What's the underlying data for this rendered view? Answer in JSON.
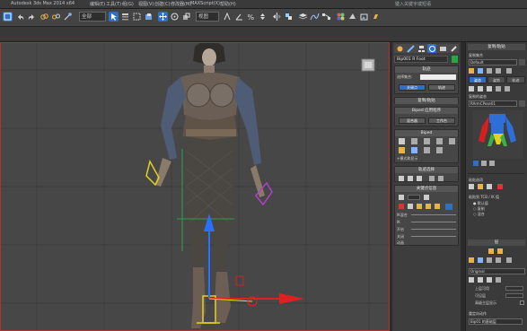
{
  "window": {
    "title_left": "Autodesk 3ds Max 2014 x64",
    "menu": [
      "编辑(E)",
      "工具(T)",
      "组(G)",
      "视图(V)",
      "创建(C)",
      "修改器(M)",
      "MAXScript(X)",
      "帮助(H)"
    ],
    "search": "键入关键字或短语"
  },
  "toolbar": {
    "selection_filter": "全部",
    "view_dropdown": "视图",
    "icons": [
      "undo-icon",
      "redo-icon",
      "link-icon",
      "unlink-icon",
      "bind-icon",
      "select-icon",
      "select-name-icon",
      "rect-select-icon",
      "window-crossing-icon",
      "move-icon",
      "rotate-icon",
      "scale-icon",
      "snap-icon",
      "angle-snap-icon",
      "percent-snap-icon",
      "spinner-snap-icon",
      "mirror-icon",
      "align-icon",
      "layer-icon",
      "curve-editor-icon",
      "schematic-icon",
      "material-editor-icon",
      "render-setup-icon",
      "render-frame-icon",
      "render-icon"
    ]
  },
  "command_panel": {
    "tabs": [
      "create-tab-icon",
      "modify-tab-icon",
      "hierarchy-tab-icon",
      "motion-tab-icon",
      "display-tab-icon",
      "utilities-tab-icon"
    ],
    "object_name": "Bip001 R Foot",
    "biped_rollout": {
      "title": "轨迹",
      "label": "选择集合:",
      "field": "无",
      "buttons": [
        "关键点",
        "轨迹"
      ]
    },
    "keyframe_rollout": {
      "title": "复制/粘贴"
    },
    "layers_rollout": {
      "title": "Biped 应用程序",
      "buttons": [
        "混合器",
        "工作台"
      ]
    },
    "biped_main": {
      "title": "Biped",
      "footer": "+模式和显示"
    },
    "track_rollout": {
      "title": "轨迹选择"
    },
    "copy_rollout": {
      "title": "关键点信息"
    },
    "ik_labels": [
      "IK混合",
      "IK",
      "开启",
      "关闭",
      "动画"
    ]
  },
  "right_panel": {
    "title": "复制/粘贴",
    "collection_label": "复制集合",
    "collection_value": "Default",
    "tabs": [
      "姿态",
      "姿势",
      "轨迹"
    ],
    "copied_label": "复制的姿态",
    "copied_value": "RArmCPose01",
    "options_title": "粘贴选项",
    "option_label": "粘贴到 TCB / IK 值",
    "radio": [
      "默认值",
      "复制",
      "混合"
    ],
    "lower_title": "层",
    "lower_field": "Original",
    "rows": [
      "上层可用",
      "可见层",
      "高级主层显示"
    ],
    "section": "重定向动作",
    "dropdown": "Bip01 的基础层"
  },
  "colors": {
    "viewport_border": "#aa3333",
    "accent_blue": "#2f6fc7",
    "axis_x": "#e02020",
    "axis_y": "#2a70ff",
    "gizmo_yellow": "#e3d21c",
    "grid": "#3a3a3a"
  }
}
